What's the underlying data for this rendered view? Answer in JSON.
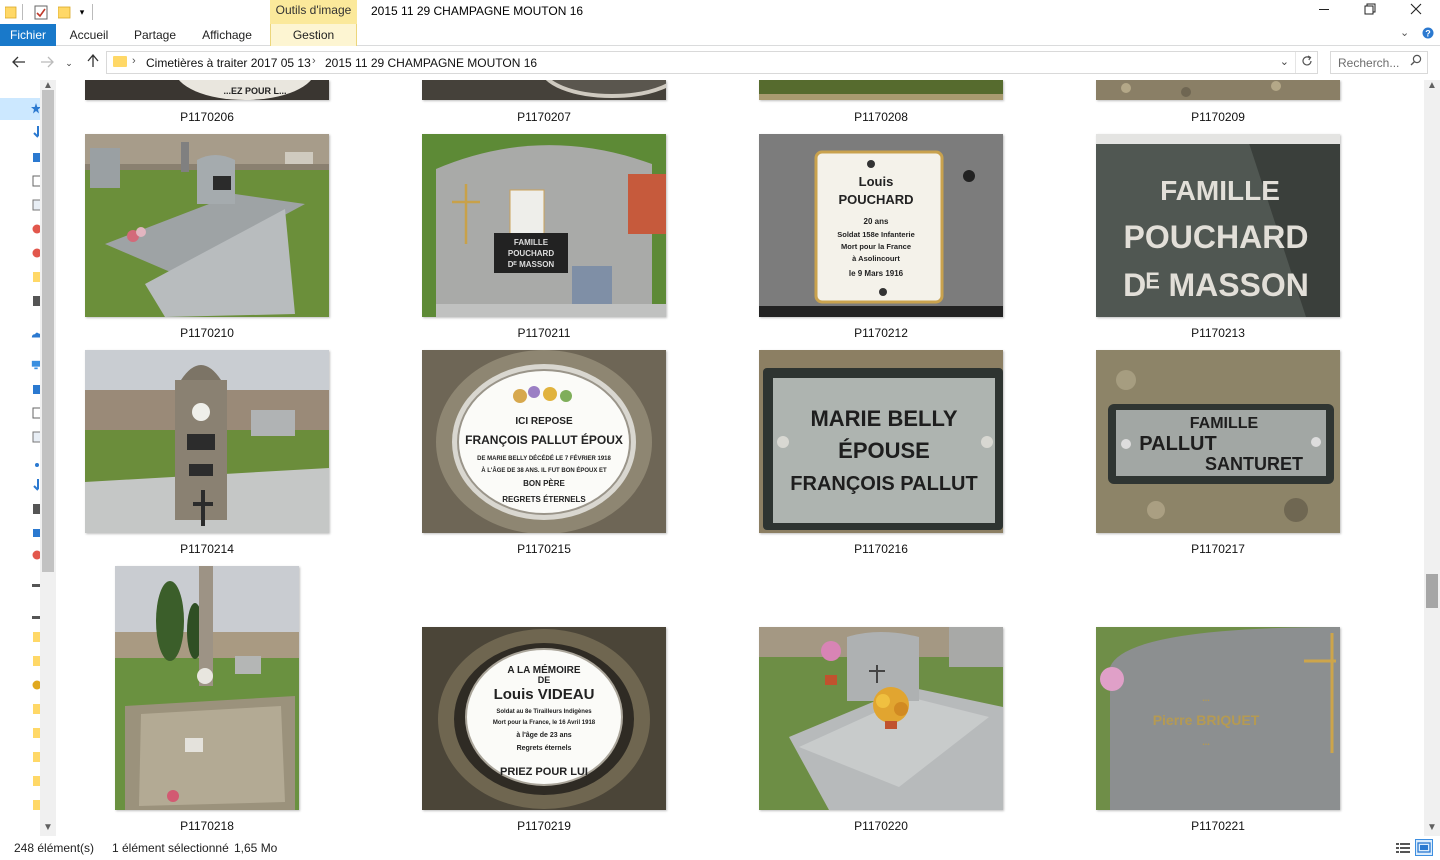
{
  "window": {
    "title": "2015 11 29 CHAMPAGNE  MOUTON 16",
    "context_tab_header": "Outils d'image"
  },
  "ribbon": {
    "tabs": [
      "Fichier",
      "Accueil",
      "Partage",
      "Affichage"
    ],
    "context_tab": "Gestion"
  },
  "address": {
    "parts": [
      "Cimetières à traiter 2017 05 13",
      "2015 11 29 CHAMPAGNE  MOUTON 16"
    ]
  },
  "search": {
    "placeholder": "Recherch..."
  },
  "icons": {
    "back": "back-arrow-icon",
    "forward": "forward-arrow-icon",
    "up": "up-arrow-icon",
    "refresh": "refresh-icon",
    "search": "search-icon",
    "folder": "folder-icon"
  },
  "files": [
    {
      "name": "P1170206"
    },
    {
      "name": "P1170207"
    },
    {
      "name": "P1170208"
    },
    {
      "name": "P1170209"
    },
    {
      "name": "P1170210"
    },
    {
      "name": "P1170211"
    },
    {
      "name": "P1170212"
    },
    {
      "name": "P1170213"
    },
    {
      "name": "P1170214"
    },
    {
      "name": "P1170215"
    },
    {
      "name": "P1170216"
    },
    {
      "name": "P1170217"
    },
    {
      "name": "P1170218"
    },
    {
      "name": "P1170219"
    },
    {
      "name": "P1170220"
    },
    {
      "name": "P1170221"
    }
  ],
  "photo_text": {
    "p206": "...EZ POUR L...",
    "p211": [
      "FAMILLE",
      "POUCHARD",
      "Dᴱ MASSON"
    ],
    "p212": [
      "Louis",
      "POUCHARD",
      "20 ans",
      "Soldat 158e Infanterie",
      "Mort pour la France",
      "à Asolincourt",
      "le 9 Mars 1916"
    ],
    "p213": [
      "FAMILLE",
      "POUCHARD",
      "Dᴱ MASSON"
    ],
    "p215": [
      "ICI REPOSE",
      "FRANÇOIS PALLUT ÉPOUX",
      "DE MARIE BELLY DÉCÉDÉ LE 7 FÉVRIER 1918",
      "À L'ÂGE DE 38 ANS. IL FUT BON ÉPOUX ET",
      "BON PÈRE",
      "REGRETS ÉTERNELS"
    ],
    "p216": [
      "MARIE BELLY",
      "ÉPOUSE",
      "FRANÇOIS PALLUT"
    ],
    "p217": [
      "FAMILLE",
      "PALLUT",
      "SANTURET"
    ],
    "p219": [
      "A LA MÉMOIRE",
      "DE",
      "Louis VIDEAU",
      "Soldat au 8e Tirailleurs Indigènes",
      "Mort pour la France, le 16 Avril 1918",
      "à l'âge de 23 ans",
      "Regrets éternels",
      "PRIEZ POUR LUI"
    ],
    "p221": [
      "...",
      "Pierre BRIQUET",
      "..."
    ]
  },
  "status": {
    "count": "248 élément(s)",
    "selection": "1 élément sélectionné",
    "size": "1,65 Mo"
  },
  "colors": {
    "file_tab": "#1979ca",
    "context_header": "#fbe99b",
    "selection": "#cce8ff"
  }
}
